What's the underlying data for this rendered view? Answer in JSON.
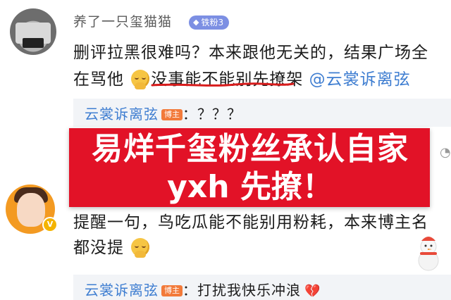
{
  "comment1": {
    "username": "养了一只玺猫猫",
    "fan_badge": "铁粉3",
    "text_a": "删评拉黑很难吗？本来跟他无关的，结果广场全",
    "text_b1": "在骂他",
    "text_b2": "没事能不能别先撩架",
    "mention": "@云裳诉离弦",
    "emoji": "facepalm-smile-emoji"
  },
  "reply1": {
    "name": "云裳诉离弦",
    "badge": "博主",
    "text": "：？？？"
  },
  "banner": {
    "line1": "易烊千玺粉丝承认自家",
    "line2": "yxh 先撩！",
    "color": "#e21227"
  },
  "comment2": {
    "text_a": "提醒一句，鸟吃瓜能不能别用粉耗，本来博主名",
    "text_b": "都没提",
    "emoji": "facepalm-smile-emoji"
  },
  "reply2": {
    "name": "云裳诉离弦",
    "badge": "博主",
    "text": "：打扰我快乐冲浪",
    "emoji": "broken-heart-icon"
  },
  "colors": {
    "link": "#3f7ed1",
    "badge_fan": "#7c8fe3",
    "badge_blogger": "#f27a3a"
  }
}
